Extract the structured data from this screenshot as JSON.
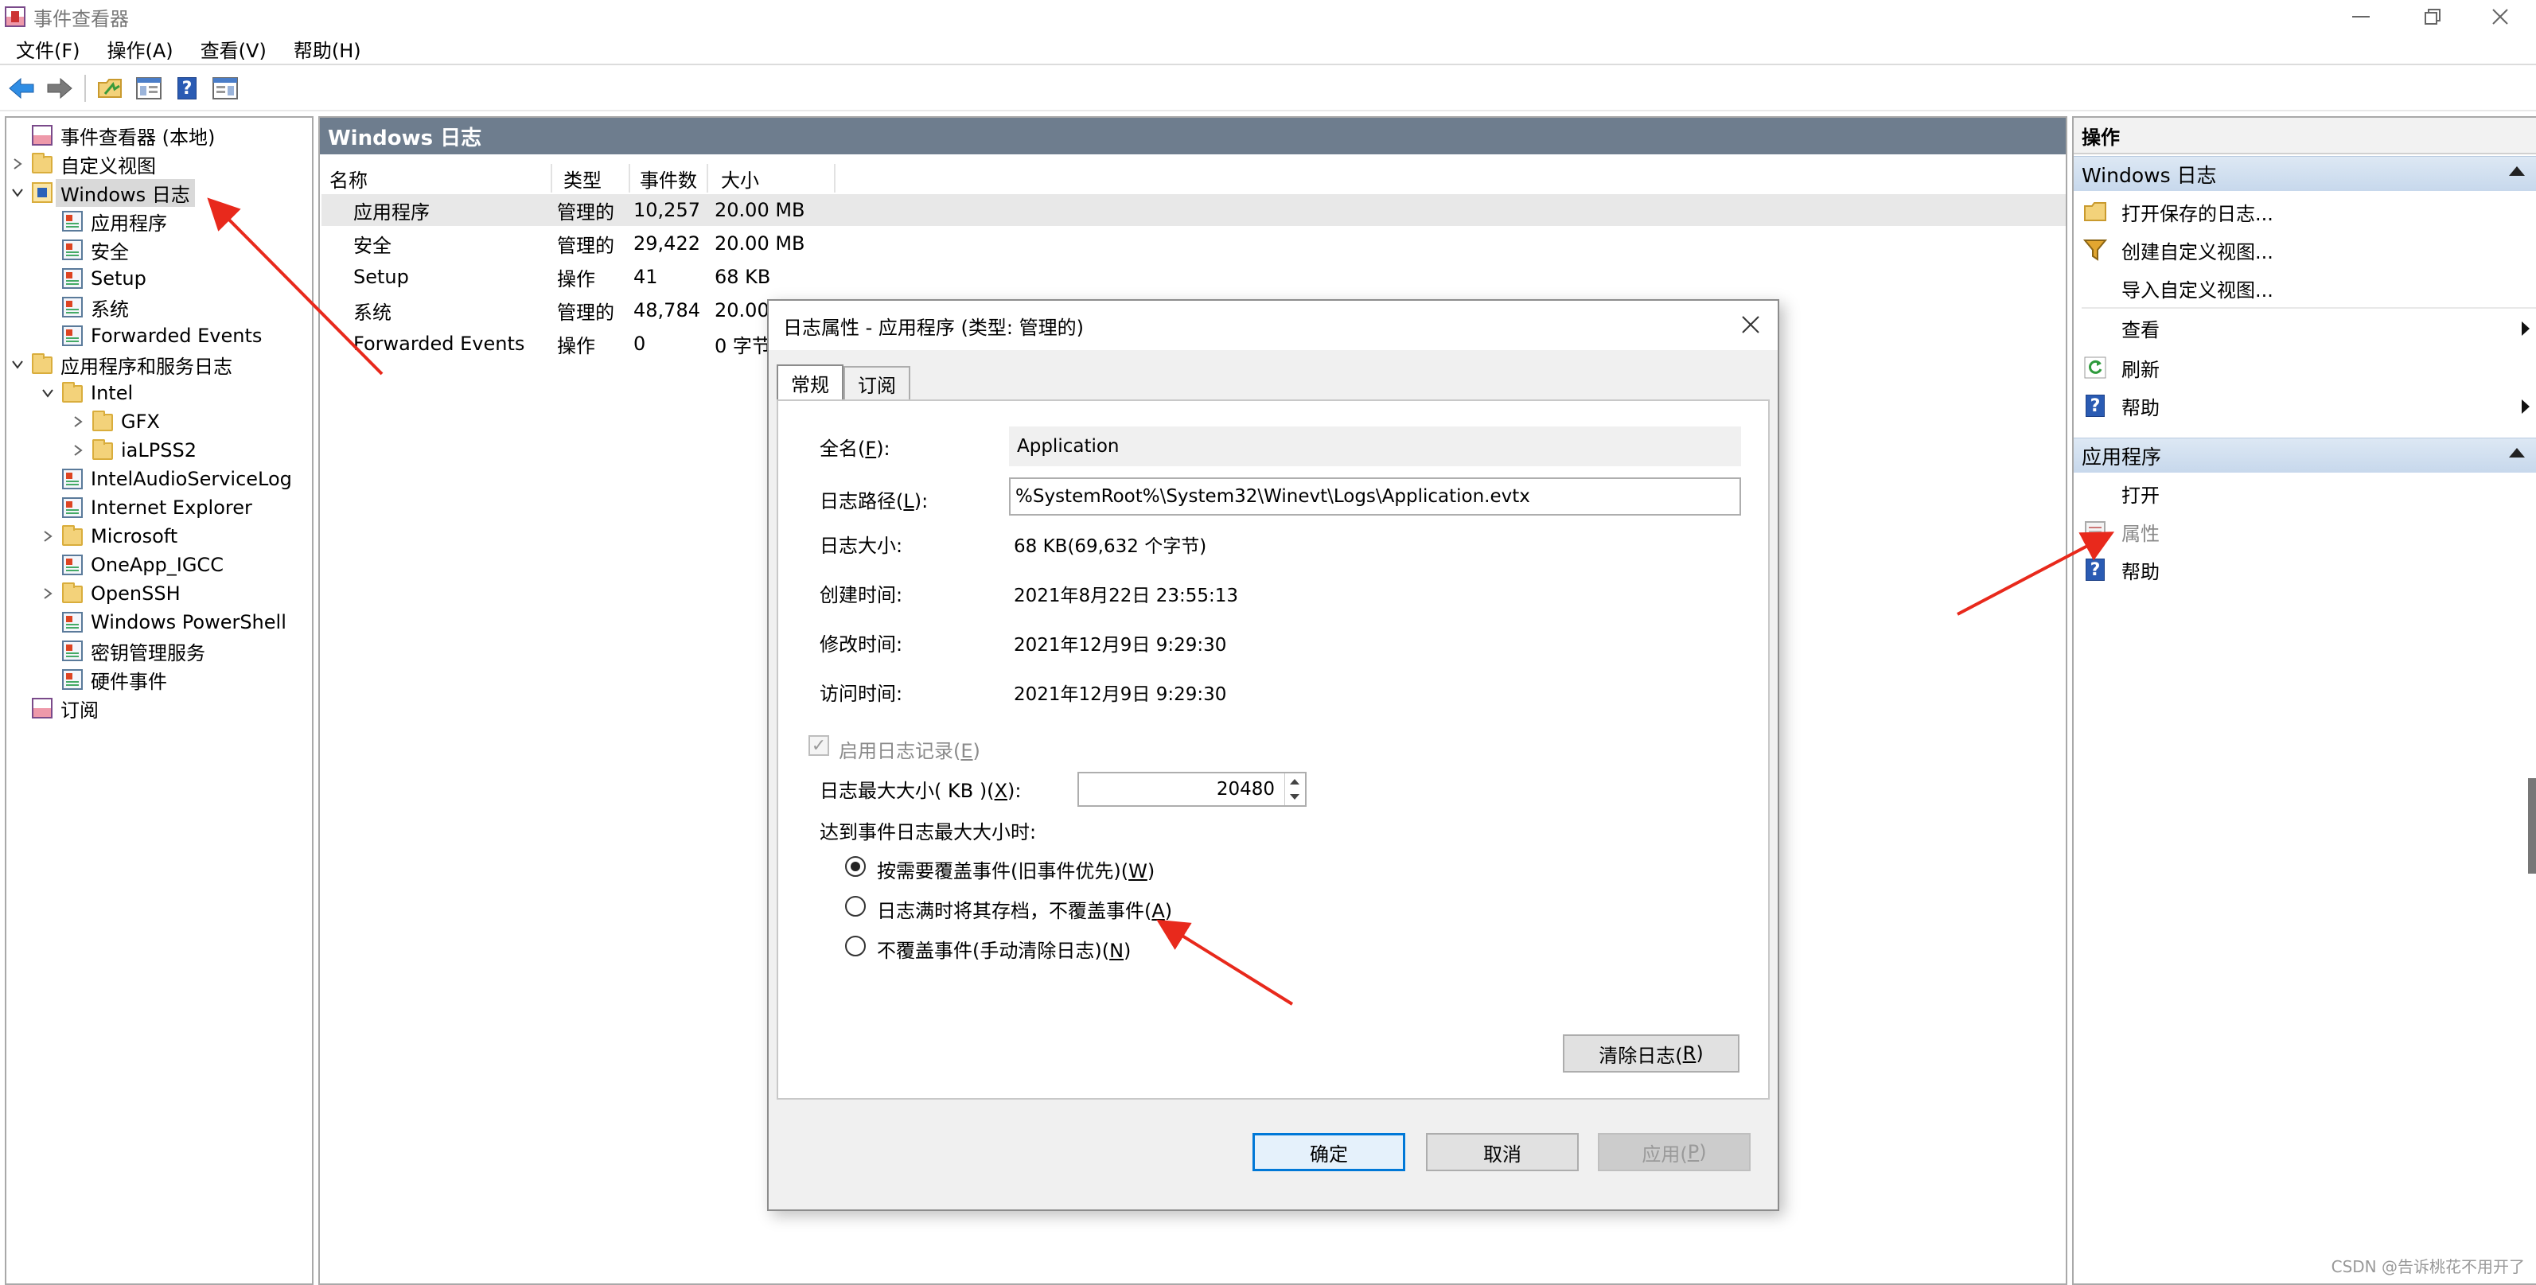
{
  "window": {
    "title": "事件查看器"
  },
  "menu": [
    "文件(F)",
    "操作(A)",
    "查看(V)",
    "帮助(H)"
  ],
  "toolbar": {
    "icons": [
      "back-arrow-icon",
      "forward-arrow-icon",
      "open-folder-icon",
      "show-hide-tree-icon",
      "help-icon",
      "show-hide-action-pane-icon"
    ]
  },
  "tree": [
    {
      "label": "事件查看器 (本地)",
      "icon": "root"
    },
    {
      "label": "自定义视图",
      "icon": "folder"
    },
    {
      "label": "Windows 日志",
      "icon": "win"
    },
    {
      "label": "应用程序",
      "icon": "log"
    },
    {
      "label": "安全",
      "icon": "log"
    },
    {
      "label": "Setup",
      "icon": "log"
    },
    {
      "label": "系统",
      "icon": "log"
    },
    {
      "label": "Forwarded Events",
      "icon": "log"
    },
    {
      "label": "应用程序和服务日志",
      "icon": "folder"
    },
    {
      "label": "Intel",
      "icon": "folder"
    },
    {
      "label": "GFX",
      "icon": "folder"
    },
    {
      "label": "iaLPSS2",
      "icon": "folder"
    },
    {
      "label": "IntelAudioServiceLog",
      "icon": "log"
    },
    {
      "label": "Internet Explorer",
      "icon": "log"
    },
    {
      "label": "Microsoft",
      "icon": "folder"
    },
    {
      "label": "OneApp_IGCC",
      "icon": "log"
    },
    {
      "label": "OpenSSH",
      "icon": "folder"
    },
    {
      "label": "Windows PowerShell",
      "icon": "log"
    },
    {
      "label": "密钥管理服务",
      "icon": "log"
    },
    {
      "label": "硬件事件",
      "icon": "log"
    },
    {
      "label": "订阅",
      "icon": "root"
    }
  ],
  "center": {
    "header": "Windows 日志",
    "columns": [
      "名称",
      "类型",
      "事件数",
      "大小"
    ],
    "rows": [
      [
        "应用程序",
        "管理的",
        "10,257",
        "20.00 MB"
      ],
      [
        "安全",
        "管理的",
        "29,422",
        "20.00 MB"
      ],
      [
        "Setup",
        "操作",
        "41",
        "68 KB"
      ],
      [
        "系统",
        "管理的",
        "48,784",
        "20.00"
      ],
      [
        "Forwarded Events",
        "操作",
        "0",
        "0 字节"
      ]
    ]
  },
  "actions": {
    "title": "操作",
    "group1": {
      "header": "Windows 日志",
      "items": [
        "打开保存的日志...",
        "创建自定义视图...",
        "导入自定义视图...",
        "查看",
        "刷新",
        "帮助"
      ]
    },
    "group2": {
      "header": "应用程序",
      "items": [
        "打开",
        "属性",
        "帮助"
      ]
    }
  },
  "dialog": {
    "title": "日志属性 - 应用程序 (类型: 管理的)",
    "tabs": [
      "常规",
      "订阅"
    ],
    "labels": {
      "fullname": "全名(",
      "fullname_key": "F",
      "fullname_end": "):",
      "path": "日志路径(",
      "path_key": "L",
      "path_end": "):",
      "size": "日志大小:",
      "created": "创建时间:",
      "modified": "修改时间:",
      "accessed": "访问时间:",
      "enable": "启用日志记录(",
      "enable_key": "E",
      "enable_end": ")",
      "maxsize": "日志最大大小( KB )(",
      "maxsize_key": "X",
      "maxsize_end": "):",
      "when_full": "达到事件日志最大大小时:"
    },
    "values": {
      "fullname": "Application",
      "path": "%SystemRoot%\\System32\\Winevt\\Logs\\Application.evtx",
      "size": "68 KB(69,632 个字节)",
      "created": "2021年8月22日 23:55:13",
      "modified": "2021年12月9日 9:29:30",
      "accessed": "2021年12月9日 9:29:30",
      "maxsize": "20480"
    },
    "radios": [
      {
        "text": "按需要覆盖事件(旧事件优先)(",
        "key": "W",
        "end": ")"
      },
      {
        "text": "日志满时将其存档，不覆盖事件(",
        "key": "A",
        "end": ")"
      },
      {
        "text": "不覆盖事件(手动清除日志)(",
        "key": "N",
        "end": ")"
      }
    ],
    "buttons": {
      "clear": "清除日志(",
      "clear_key": "R",
      "clear_end": ")",
      "ok": "确定",
      "cancel": "取消",
      "apply": "应用(",
      "apply_key": "P",
      "apply_end": ")"
    }
  },
  "watermark": "CSDN @告诉桃花不用开了",
  "colors": {
    "header_bg": "#6e7d8e",
    "group_header_bg": "#c7d8ec",
    "annotation_arrow": "#e8291c",
    "default_button_border": "#0078d7"
  }
}
